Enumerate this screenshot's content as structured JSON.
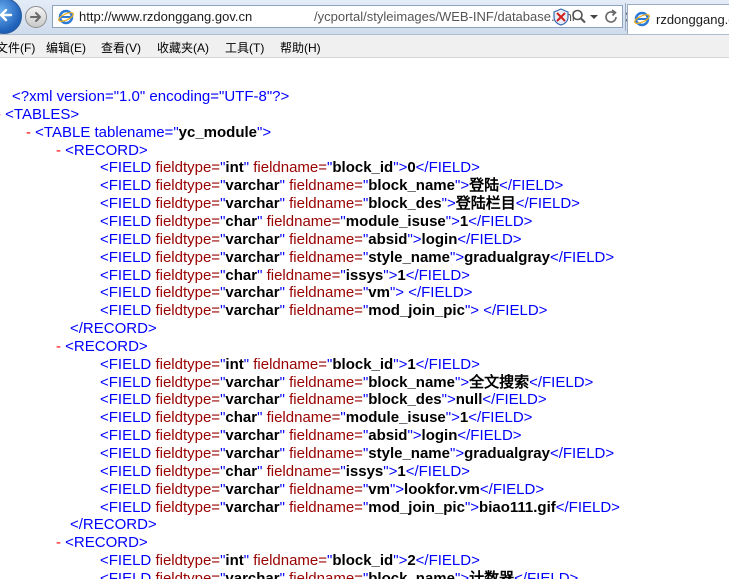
{
  "address_bar": {
    "url_host": "http://www.rzdonggang.gov.cn",
    "url_path": "/ycportal/styleimages/WEB-INF/database.xml"
  },
  "tab": {
    "title": "rzdonggang.g"
  },
  "menu": [
    {
      "label": "文件(F)"
    },
    {
      "label": "编辑(E)"
    },
    {
      "label": "查看(V)"
    },
    {
      "label": "收藏夹(A)"
    },
    {
      "label": "工具(T)"
    },
    {
      "label": "帮助(H)"
    }
  ],
  "xml": {
    "declaration": "<?xml version=\"1.0\" encoding=\"UTF-8\"?>",
    "root_open": "<TABLES>",
    "table_tag": "<TABLE tablename=\"",
    "table_name": "yc_module",
    "table_tag_end": "\">",
    "collapse_symbol": "-",
    "record_open": "<RECORD>",
    "record_close": "</RECORD>",
    "field_open": "<FIELD ",
    "fieldtype_attr": "fieldtype=",
    "fieldname_attr": "fieldname=",
    "quote": "\"",
    "tag_end": ">",
    "field_close": "</FIELD>",
    "records": [
      {
        "fields": [
          {
            "type": "int",
            "name": "block_id",
            "value": "0"
          },
          {
            "type": "varchar",
            "name": "block_name",
            "value": "登陆"
          },
          {
            "type": "varchar",
            "name": "block_des",
            "value": "登陆栏目"
          },
          {
            "type": "char",
            "name": "module_isuse",
            "value": "1"
          },
          {
            "type": "varchar",
            "name": "absid",
            "value": "login"
          },
          {
            "type": "varchar",
            "name": "style_name",
            "value": "gradualgray"
          },
          {
            "type": "char",
            "name": "issys",
            "value": "1"
          },
          {
            "type": "varchar",
            "name": "vm",
            "value": " "
          },
          {
            "type": "varchar",
            "name": "mod_join_pic",
            "value": " "
          }
        ]
      },
      {
        "fields": [
          {
            "type": "int",
            "name": "block_id",
            "value": "1"
          },
          {
            "type": "varchar",
            "name": "block_name",
            "value": "全文搜索"
          },
          {
            "type": "varchar",
            "name": "block_des",
            "value": "null"
          },
          {
            "type": "char",
            "name": "module_isuse",
            "value": "1"
          },
          {
            "type": "varchar",
            "name": "absid",
            "value": "login"
          },
          {
            "type": "varchar",
            "name": "style_name",
            "value": "gradualgray"
          },
          {
            "type": "char",
            "name": "issys",
            "value": "1"
          },
          {
            "type": "varchar",
            "name": "vm",
            "value": "lookfor.vm"
          },
          {
            "type": "varchar",
            "name": "mod_join_pic",
            "value": "biao111.gif"
          }
        ]
      },
      {
        "fields": [
          {
            "type": "int",
            "name": "block_id",
            "value": "2"
          },
          {
            "type": "varchar",
            "name": "block_name",
            "value": "计数器"
          }
        ]
      }
    ]
  }
}
